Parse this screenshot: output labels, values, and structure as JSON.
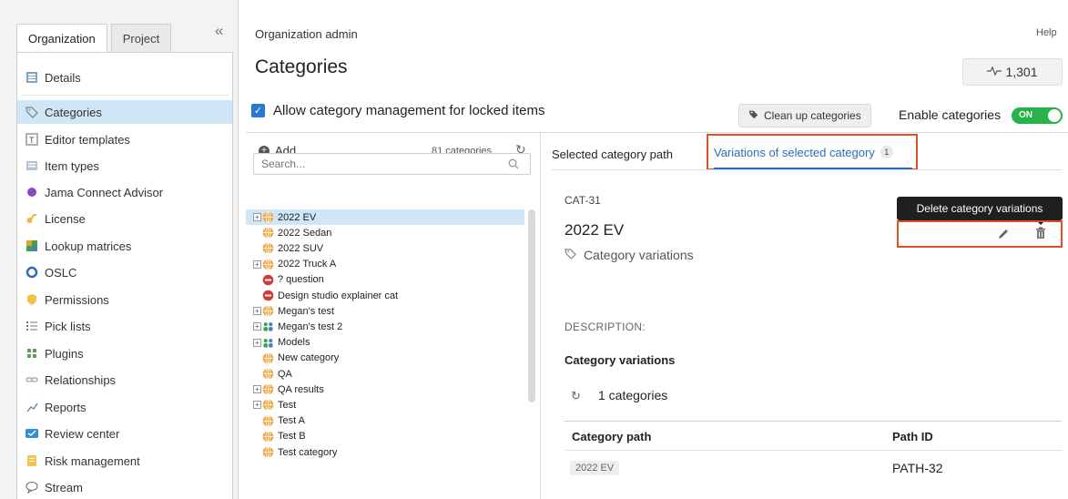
{
  "sidebar": {
    "tabs": [
      {
        "label": "Organization",
        "active": true
      },
      {
        "label": "Project",
        "active": false
      }
    ],
    "collapse_glyph": "«",
    "items": [
      {
        "label": "Details",
        "icon": "details-icon",
        "active": false
      },
      {
        "label": "Categories",
        "icon": "tag-icon",
        "active": true
      },
      {
        "label": "Editor templates",
        "icon": "template-icon",
        "active": false
      },
      {
        "label": "Item types",
        "icon": "item-types-icon",
        "active": false
      },
      {
        "label": "Jama Connect Advisor",
        "icon": "advisor-icon",
        "active": false
      },
      {
        "label": "License",
        "icon": "key-icon",
        "active": false
      },
      {
        "label": "Lookup matrices",
        "icon": "matrix-icon",
        "active": false
      },
      {
        "label": "OSLC",
        "icon": "oslc-icon",
        "active": false
      },
      {
        "label": "Permissions",
        "icon": "shield-icon",
        "active": false
      },
      {
        "label": "Pick lists",
        "icon": "list-icon",
        "active": false
      },
      {
        "label": "Plugins",
        "icon": "plugin-icon",
        "active": false
      },
      {
        "label": "Relationships",
        "icon": "link-icon",
        "active": false
      },
      {
        "label": "Reports",
        "icon": "report-icon",
        "active": false
      },
      {
        "label": "Review center",
        "icon": "review-icon",
        "active": false
      },
      {
        "label": "Risk management",
        "icon": "risk-icon",
        "active": false
      },
      {
        "label": "Stream",
        "icon": "chat-icon",
        "active": false
      }
    ]
  },
  "header": {
    "breadcrumb": "Organization admin",
    "help": "Help",
    "title": "Categories",
    "activity_count": "1,301"
  },
  "options": {
    "lock_label": "Allow category management for locked items",
    "cleanup_label": "Clean up categories",
    "enable_label": "Enable categories",
    "toggle_text": "ON"
  },
  "tree": {
    "add_label": "Add",
    "count_label": "81 categories",
    "search_placeholder": "Search...",
    "items": [
      {
        "label": "2022 EV",
        "expander": "+",
        "icon": "globe",
        "selected": true
      },
      {
        "label": "2022 Sedan",
        "expander": "",
        "icon": "globe",
        "selected": false
      },
      {
        "label": "2022 SUV",
        "expander": "",
        "icon": "globe",
        "selected": false
      },
      {
        "label": "2022 Truck A",
        "expander": "+",
        "icon": "globe",
        "selected": false
      },
      {
        "label": "? question",
        "expander": "",
        "icon": "stop",
        "selected": false
      },
      {
        "label": "Design studio explainer cat",
        "expander": "",
        "icon": "stop",
        "selected": false
      },
      {
        "label": "Megan's test",
        "expander": "+",
        "icon": "globe",
        "selected": false
      },
      {
        "label": "Megan's test 2",
        "expander": "+",
        "icon": "people",
        "selected": false
      },
      {
        "label": "Models",
        "expander": "+",
        "icon": "people",
        "selected": false
      },
      {
        "label": "New category",
        "expander": "",
        "icon": "globe",
        "selected": false
      },
      {
        "label": "QA",
        "expander": "",
        "icon": "globe",
        "selected": false
      },
      {
        "label": "QA results",
        "expander": "+",
        "icon": "globe",
        "selected": false
      },
      {
        "label": "Test",
        "expander": "+",
        "icon": "globe",
        "selected": false
      },
      {
        "label": "Test A",
        "expander": "",
        "icon": "globe",
        "selected": false
      },
      {
        "label": "Test B",
        "expander": "",
        "icon": "globe",
        "selected": false
      },
      {
        "label": "Test category",
        "expander": "",
        "icon": "globe",
        "selected": false
      }
    ]
  },
  "detail": {
    "tabs": [
      {
        "label": "Selected category path"
      },
      {
        "label": "Variations of selected category",
        "badge": "1"
      }
    ],
    "item_id": "CAT-31",
    "item_name": "2022 EV",
    "item_sub": "Category variations",
    "tooltip": "Delete category variations",
    "description_label": "DESCRIPTION:",
    "variations_heading": "Category variations",
    "variations_count": "1 categories",
    "table": {
      "columns": [
        "Category path",
        "Path ID"
      ],
      "rows": [
        {
          "path": "2022 EV",
          "path_id": "PATH-32"
        }
      ]
    }
  },
  "colors": {
    "accent_blue": "#2a6ebb",
    "highlight_red": "#e0502a",
    "toggle_green": "#27b24a",
    "selected_bg": "#cfe6f7"
  }
}
